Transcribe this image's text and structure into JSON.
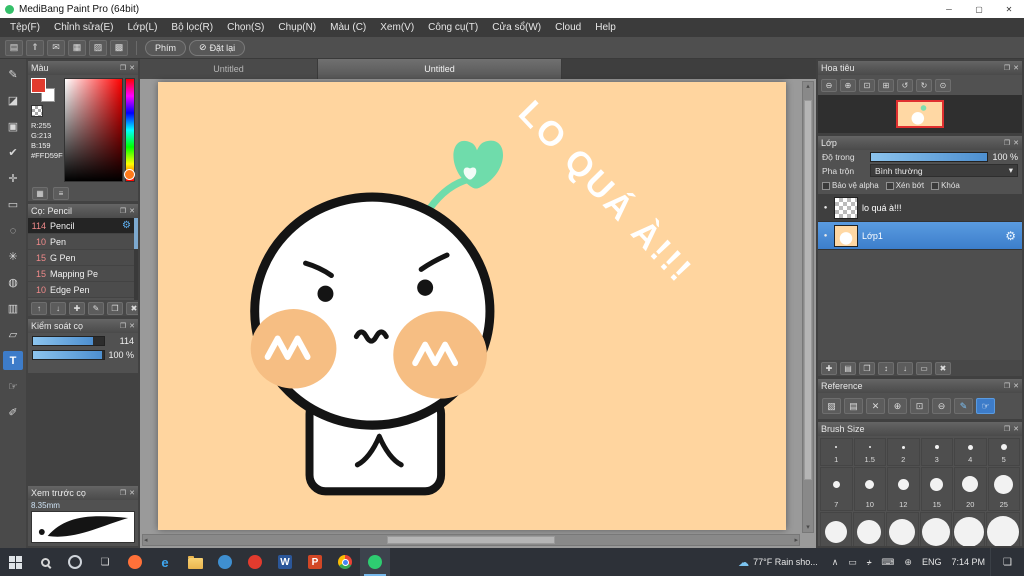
{
  "window": {
    "title": "MediBang Paint Pro (64bit)"
  },
  "ui": {
    "popout_glyph": "❐",
    "close_glyph": "✕",
    "min_glyph": "─",
    "max_glyph": "▢",
    "gear_glyph": "⚙",
    "dropdown_arrow": "▾",
    "eye_glyph": "●",
    "scroll_up": "▴",
    "scroll_down": "▾",
    "scroll_left": "◂",
    "scroll_right": "▸"
  },
  "menu": {
    "items": [
      "Tệp(F)",
      "Chỉnh sửa(E)",
      "Lớp(L)",
      "Bộ lọc(R)",
      "Chọn(S)",
      "Chụp(N)",
      "Màu (C)",
      "Xem(V)",
      "Công cụ(T)",
      "Cửa sổ(W)",
      "Cloud",
      "Help"
    ]
  },
  "toolbar": {
    "icons": [
      {
        "name": "new-canvas-icon",
        "glyph": "▤"
      },
      {
        "name": "export-icon",
        "glyph": "⇑"
      },
      {
        "name": "comment-icon",
        "glyph": "✉"
      },
      {
        "name": "palette-icon",
        "glyph": "▦"
      },
      {
        "name": "material-icon",
        "glyph": "▨"
      },
      {
        "name": "grid-icon",
        "glyph": "▩"
      }
    ],
    "phim_label": "Phím",
    "reset_icon": "⊘",
    "reset_label": "Đặt lại"
  },
  "toolstrip": {
    "tools": [
      {
        "name": "brush-tool",
        "glyph": "✎"
      },
      {
        "name": "eraser-tool",
        "glyph": "◪"
      },
      {
        "name": "fill-tool",
        "glyph": "▣"
      },
      {
        "name": "select-pen-tool",
        "glyph": "✔"
      },
      {
        "name": "move-tool",
        "glyph": "✛"
      },
      {
        "name": "rect-select-tool",
        "glyph": "▭"
      },
      {
        "name": "lasso-tool",
        "glyph": "◌"
      },
      {
        "name": "magic-wand-tool",
        "glyph": "✳"
      },
      {
        "name": "bucket-tool",
        "glyph": "◍"
      },
      {
        "name": "gradient-tool",
        "glyph": "▥"
      },
      {
        "name": "shape-tool",
        "glyph": "▱"
      },
      {
        "name": "text-tool",
        "glyph": "T",
        "selected": true
      },
      {
        "name": "pan-tool",
        "glyph": "☞"
      },
      {
        "name": "eyedropper-tool",
        "glyph": "✐"
      }
    ]
  },
  "tabs": [
    {
      "label": "Untitled",
      "active": false
    },
    {
      "label": "Untitled",
      "active": true
    }
  ],
  "color_panel": {
    "title": "Màu",
    "r": "R:255",
    "g": "G:213",
    "b": "B:159",
    "hex": "#FFD59F"
  },
  "brush_panel": {
    "title": "Cọ: Pencil",
    "brushes": [
      {
        "size": "114",
        "name": "Pencil",
        "selected": true
      },
      {
        "size": "10",
        "name": "Pen",
        "selected": false
      },
      {
        "size": "15",
        "name": "G Pen",
        "selected": false
      },
      {
        "size": "15",
        "name": "Mapping Pe",
        "selected": false
      },
      {
        "size": "10",
        "name": "Edge Pen",
        "selected": false
      }
    ],
    "footer_icons": [
      {
        "name": "brush-up-icon",
        "glyph": "↑"
      },
      {
        "name": "brush-down-icon",
        "glyph": "↓"
      },
      {
        "name": "add-brush-icon",
        "glyph": "✚"
      },
      {
        "name": "edit-brush-icon",
        "glyph": "✎"
      },
      {
        "name": "duplicate-brush-icon",
        "glyph": "❐"
      },
      {
        "name": "delete-brush-icon",
        "glyph": "✖"
      }
    ]
  },
  "brush_control_panel": {
    "title": "Kiểm soát cọ",
    "size_value": "114",
    "opacity_value": "100 %"
  },
  "preview_panel": {
    "title": "Xem trước cọ",
    "size_label": "8.35mm"
  },
  "navigator_panel": {
    "title": "Hoa tiêu",
    "icons": [
      {
        "name": "nav-zoom-out-icon",
        "glyph": "⊖"
      },
      {
        "name": "nav-zoom-in-icon",
        "glyph": "⊕"
      },
      {
        "name": "nav-fit-icon",
        "glyph": "⊡"
      },
      {
        "name": "nav-actual-size-icon",
        "glyph": "⊞"
      },
      {
        "name": "nav-rotate-left-icon",
        "glyph": "↺"
      },
      {
        "name": "nav-rotate-right-icon",
        "glyph": "↻"
      },
      {
        "name": "nav-reset-icon",
        "glyph": "⊙"
      }
    ]
  },
  "layer_panel": {
    "title": "Lớp",
    "opacity_label": "Độ trong",
    "opacity_value": "100 %",
    "blend_label": "Pha trộn",
    "blend_value": "Bình thường",
    "checkboxes": [
      "Bảo vệ alpha",
      "Xén bớt",
      "Khóa"
    ],
    "layers": [
      {
        "name": "lo quá à!!!",
        "thumb": "checker",
        "selected": false
      },
      {
        "name": "Lớp1",
        "thumb": "peach",
        "selected": true
      }
    ],
    "footer_icons": [
      {
        "name": "add-layer-icon",
        "glyph": "✚"
      },
      {
        "name": "layer-folder-icon",
        "glyph": "▤"
      },
      {
        "name": "duplicate-layer-icon",
        "glyph": "❐"
      },
      {
        "name": "move-layer-icon",
        "glyph": "↕"
      },
      {
        "name": "merge-layer-icon",
        "glyph": "↓"
      },
      {
        "name": "clear-layer-icon",
        "glyph": "▭"
      },
      {
        "name": "delete-layer-icon",
        "glyph": "✖"
      }
    ]
  },
  "reference_panel": {
    "title": "Reference",
    "icons": [
      {
        "name": "ref-image-icon",
        "glyph": "▧"
      },
      {
        "name": "ref-folder-icon",
        "glyph": "▤"
      },
      {
        "name": "ref-close-icon",
        "glyph": "✕"
      },
      {
        "name": "ref-zoom-in-icon",
        "glyph": "⊕"
      },
      {
        "name": "ref-fit-icon",
        "glyph": "⊡"
      },
      {
        "name": "ref-zoom-out-icon",
        "glyph": "⊖"
      },
      {
        "name": "ref-pencil-icon",
        "glyph": "✎",
        "accent": true
      },
      {
        "name": "ref-hand-icon",
        "glyph": "☞",
        "selected": true
      }
    ]
  },
  "brush_size_panel": {
    "title": "Brush Size",
    "rows": [
      {
        "labels": [
          "1",
          "1.5",
          "2",
          "3",
          "4",
          "5"
        ],
        "dots": [
          2,
          2,
          3,
          4,
          5,
          6
        ]
      },
      {
        "labels": [
          "7",
          "10",
          "12",
          "15",
          "20",
          "25"
        ],
        "dots": [
          7,
          9,
          11,
          13,
          16,
          19
        ]
      },
      {
        "labels": [
          "",
          "",
          "",
          "",
          "",
          ""
        ],
        "dots": [
          22,
          24,
          26,
          28,
          30,
          32
        ]
      }
    ]
  },
  "canvas": {
    "bg": "#FFD59F",
    "text": "LO QUÁ À!!!",
    "blush_color": "#F6BE83",
    "leaf_color": "#6FDCAB"
  },
  "taskbar": {
    "apps": [
      {
        "name": "start-button",
        "type": "win"
      },
      {
        "name": "search-button",
        "type": "mag"
      },
      {
        "name": "cortana-button",
        "type": "circle",
        "color": "#cfd4da",
        "hollow": true
      },
      {
        "name": "task-view-button",
        "type": "glyph",
        "glyph": "❏"
      },
      {
        "name": "firefox-icon",
        "type": "circle",
        "color": "#ff7139"
      },
      {
        "name": "edge-icon",
        "type": "letter",
        "glyph": "e",
        "color": "#3ea6f0",
        "plain": true
      },
      {
        "name": "file-explorer-icon",
        "type": "folder"
      },
      {
        "name": "app-blue-icon",
        "type": "circle",
        "color": "#3f8fd0"
      },
      {
        "name": "app-red-icon",
        "type": "circle",
        "color": "#e23b2e"
      },
      {
        "name": "word-icon",
        "type": "letter",
        "glyph": "W",
        "color": "#2b579a"
      },
      {
        "name": "powerpoint-icon",
        "type": "letter",
        "glyph": "P",
        "color": "#d24726"
      },
      {
        "name": "chrome-icon",
        "type": "chrome"
      },
      {
        "name": "medibang-icon",
        "type": "circle",
        "color": "#2ecc71",
        "active": true
      }
    ],
    "weather_icon": "☁",
    "weather_text": "77°F  Rain sho...",
    "tray_icons": [
      {
        "name": "tray-expand-icon",
        "glyph": "∧"
      },
      {
        "name": "display-icon",
        "glyph": "▭"
      },
      {
        "name": "mute-icon",
        "glyph": "♪",
        "muted": true
      },
      {
        "name": "keyboard-icon",
        "glyph": "⌨"
      },
      {
        "name": "globe-icon",
        "glyph": "⊕"
      }
    ],
    "lang": "ENG",
    "time": "7:14 PM",
    "notification_glyph": "❏"
  }
}
